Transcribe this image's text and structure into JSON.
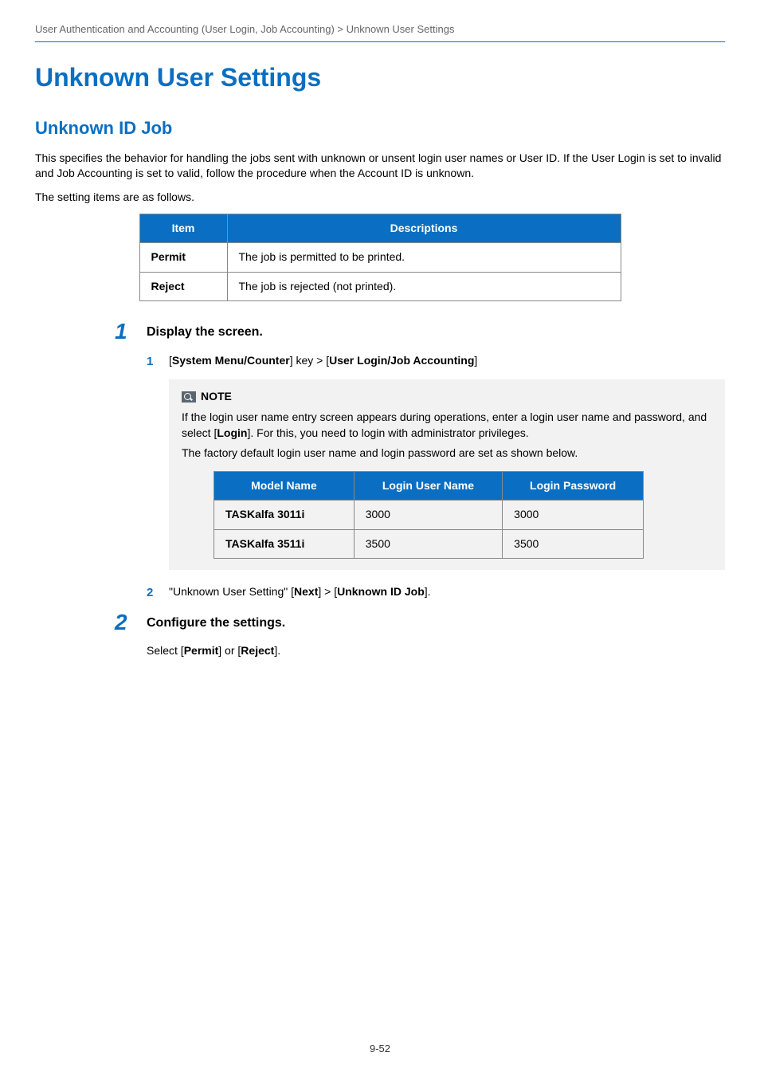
{
  "breadcrumb": "User Authentication and Accounting (User Login, Job Accounting) > Unknown User Settings",
  "h1": "Unknown User Settings",
  "h2": "Unknown ID Job",
  "intro1": "This specifies the behavior for handling the jobs sent with unknown or unsent login user names or User ID. If the User Login is set to invalid and Job Accounting is set to valid, follow the procedure when the Account ID is unknown.",
  "intro2": "The setting items are as follows.",
  "table1": {
    "headers": [
      "Item",
      "Descriptions"
    ],
    "rows": [
      {
        "item": "Permit",
        "desc": "The job is permitted to be printed."
      },
      {
        "item": "Reject",
        "desc": "The job is rejected (not printed)."
      }
    ]
  },
  "step1": {
    "num": "1",
    "title": "Display the screen.",
    "sub1": {
      "num": "1",
      "before": "[",
      "b1": "System Menu/Counter",
      "mid1": "] key > [",
      "b2": "User Login/Job Accounting",
      "after": "]"
    },
    "note": {
      "label": "NOTE",
      "line1a": "If the login user name entry screen appears during operations, enter a login user name and password, and select [",
      "line1b": "Login",
      "line1c": "]. For this, you need to login with administrator privileges.",
      "line2": "The factory default login user name and login password are set as shown below."
    },
    "table2": {
      "headers": [
        "Model Name",
        "Login User Name",
        "Login Password"
      ],
      "rows": [
        {
          "model": "TASKalfa 3011i",
          "user": "3000",
          "pass": "3000"
        },
        {
          "model": "TASKalfa 3511i",
          "user": "3500",
          "pass": "3500"
        }
      ]
    },
    "sub2": {
      "num": "2",
      "a": "\"Unknown User Setting\" [",
      "b1": "Next",
      "b": "] > [",
      "b2": "Unknown ID Job",
      "c": "]."
    }
  },
  "step2": {
    "num": "2",
    "title": "Configure the settings.",
    "line_a": "Select [",
    "line_b1": "Permit",
    "line_b": "] or [",
    "line_b2": "Reject",
    "line_c": "]."
  },
  "page_num": "9-52"
}
